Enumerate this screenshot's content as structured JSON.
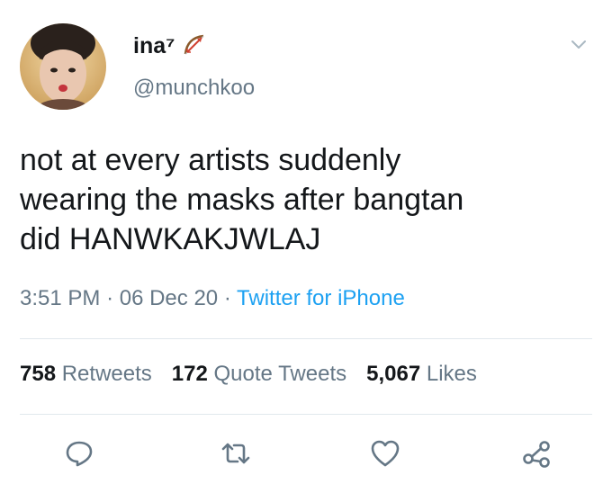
{
  "tweet": {
    "display_name": "ina",
    "name_superscript": "⁷",
    "name_emoji_icon": "bow-and-arrow-icon",
    "handle": "@munchkoo",
    "text_lines": [
      "not at every artists suddenly",
      "wearing the masks after bangtan",
      "did HANWKAKJWLAJ"
    ],
    "time": "3:51 PM",
    "date": "06 Dec 20",
    "separator": "·",
    "source": "Twitter for iPhone",
    "stats": {
      "retweets_count": "758",
      "retweets_label": "Retweets",
      "quotes_count": "172",
      "quotes_label": "Quote Tweets",
      "likes_count": "5,067",
      "likes_label": "Likes"
    }
  },
  "colors": {
    "text": "#14171a",
    "secondary": "#657786",
    "link": "#1da1f2",
    "divider": "#e1e8ed",
    "icon": "#657786"
  },
  "icons": [
    "chevron-down-icon",
    "reply-icon",
    "retweet-icon",
    "like-icon",
    "share-icon"
  ]
}
